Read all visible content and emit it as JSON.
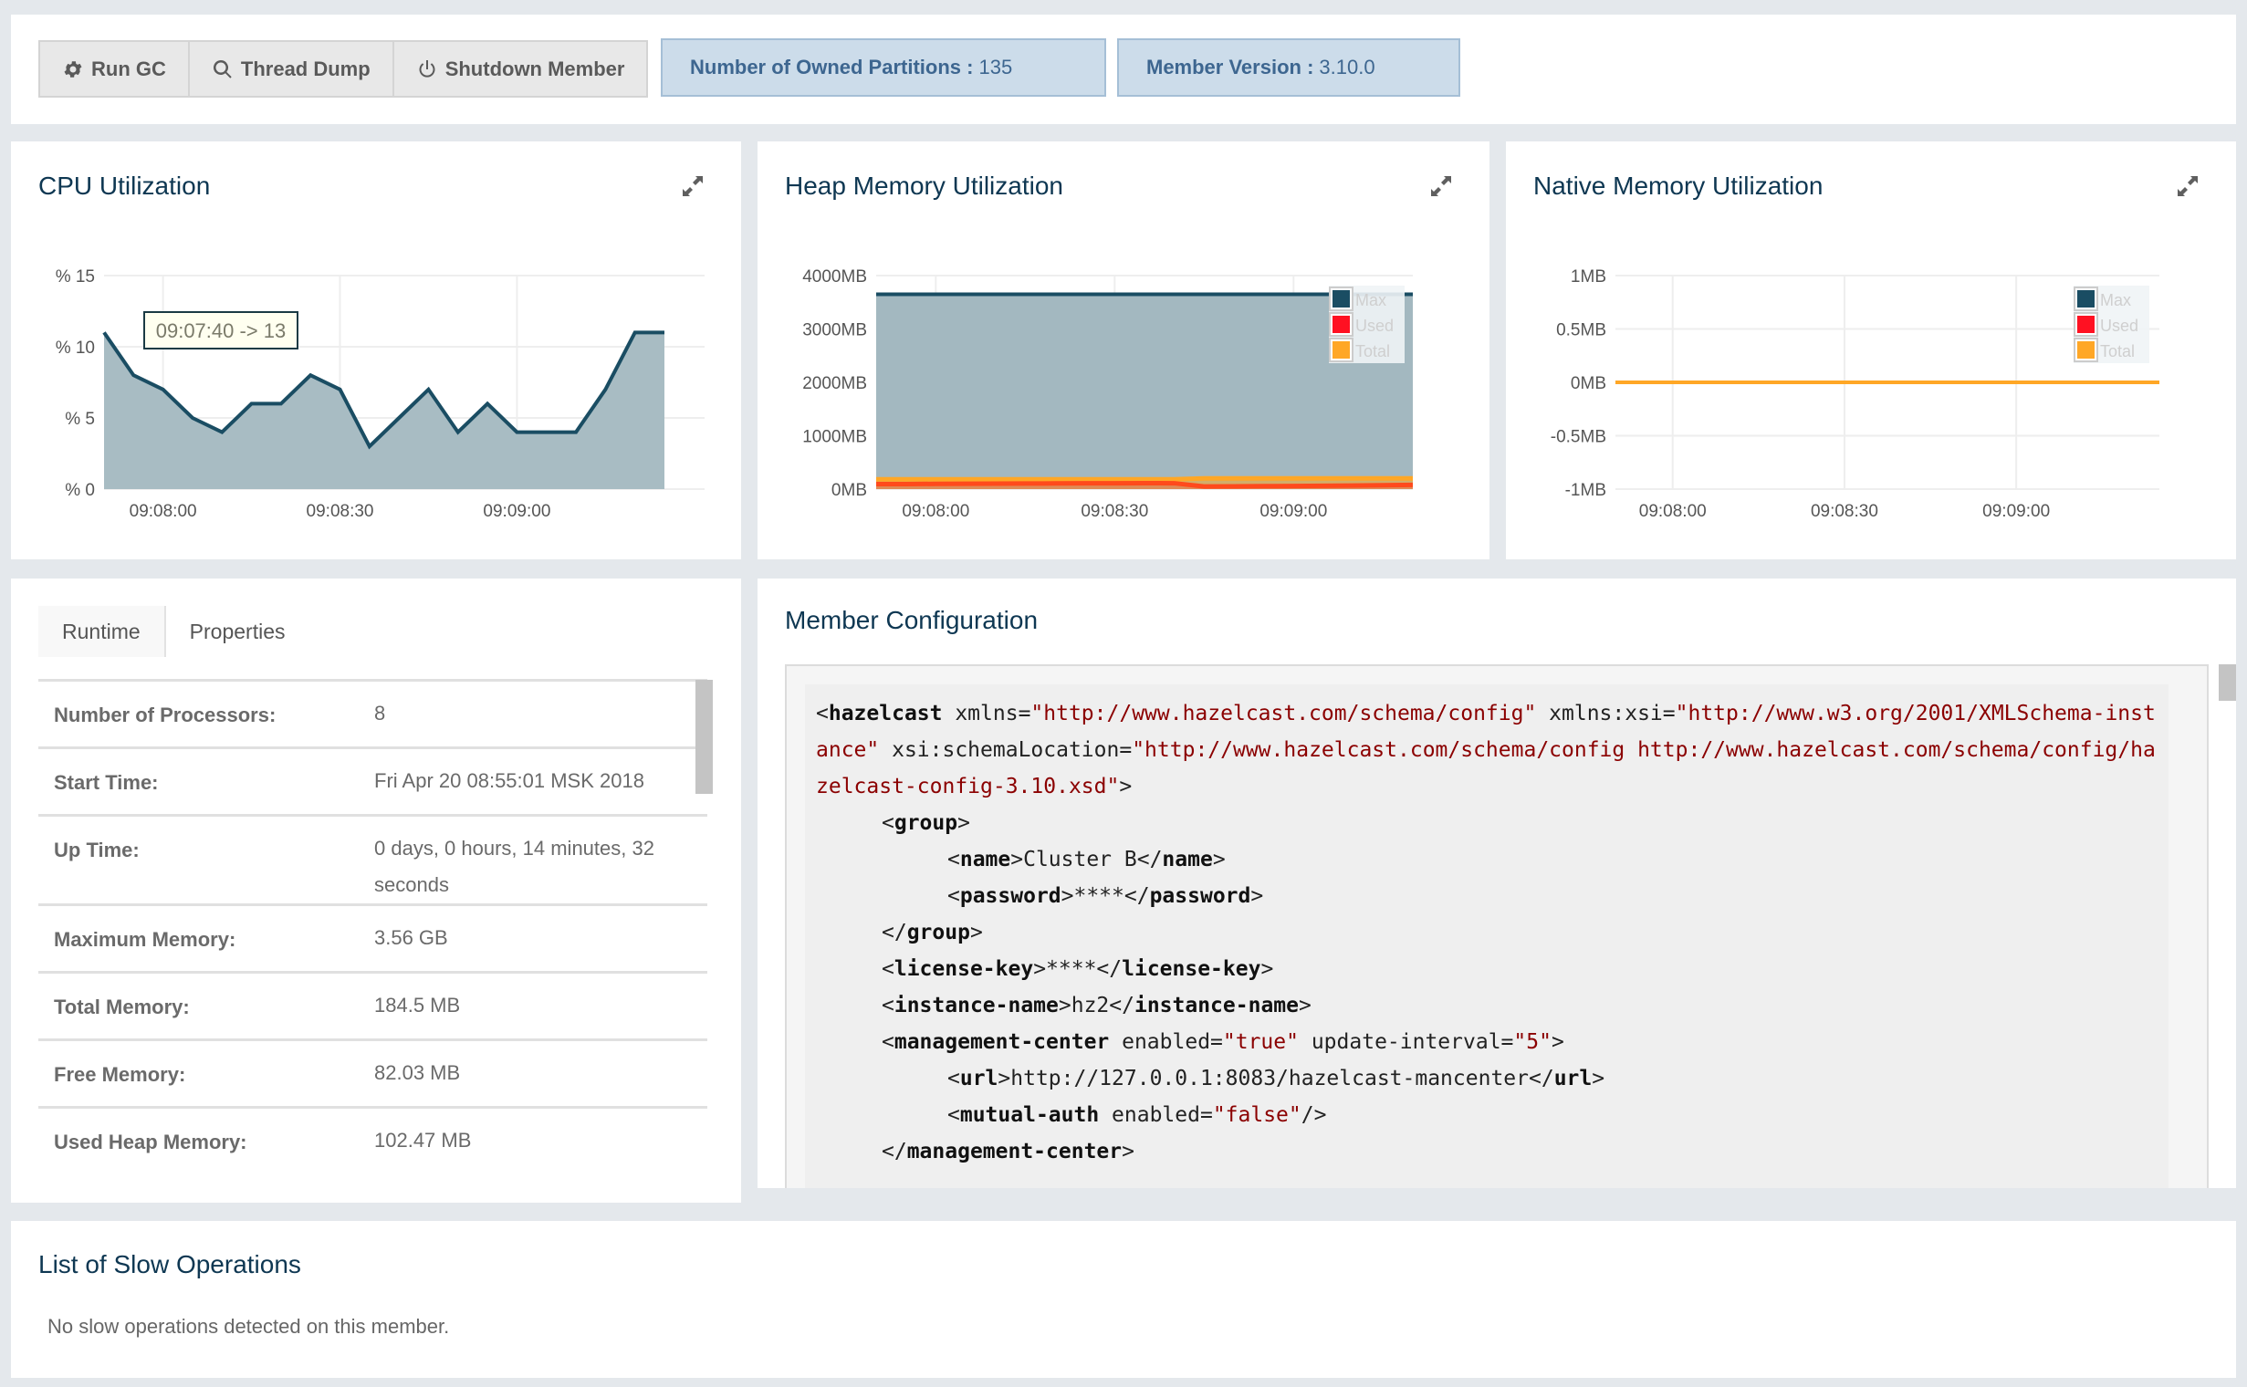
{
  "toolbar": {
    "buttons": [
      {
        "label": "Run GC",
        "icon": "gear-icon"
      },
      {
        "label": "Thread Dump",
        "icon": "search-icon"
      },
      {
        "label": "Shutdown Member",
        "icon": "power-icon"
      }
    ],
    "partitions": {
      "label": "Number of Owned Partitions :",
      "value": "135"
    },
    "version": {
      "label": "Member Version :",
      "value": "3.10.0"
    }
  },
  "charts": {
    "cpu": {
      "title": "CPU Utilization",
      "tooltip": "09:07:40 -> 13"
    },
    "heap": {
      "title": "Heap Memory Utilization"
    },
    "native": {
      "title": "Native Memory Utilization"
    }
  },
  "chart_data": [
    {
      "type": "area",
      "title": "CPU Utilization",
      "x": [
        "09:07:50",
        "09:07:55",
        "09:08:00",
        "09:08:05",
        "09:08:10",
        "09:08:15",
        "09:08:20",
        "09:08:25",
        "09:08:30",
        "09:08:35",
        "09:08:40",
        "09:08:45",
        "09:08:50",
        "09:08:55",
        "09:09:00",
        "09:09:05",
        "09:09:10",
        "09:09:15",
        "09:09:20",
        "09:09:25"
      ],
      "series": [
        {
          "name": "CPU",
          "values": [
            11,
            8,
            7,
            5,
            4,
            6,
            6,
            8,
            7,
            3,
            5,
            7,
            4,
            6,
            4,
            4,
            4,
            7,
            11,
            11
          ],
          "color": "#1a4d63",
          "fill": "#a3b8c0"
        }
      ],
      "yticks": [
        "% 0",
        "% 5",
        "% 10",
        "% 15"
      ],
      "ylim": [
        0,
        15
      ],
      "xticks": [
        "09:08:00",
        "09:08:30",
        "09:09:00"
      ],
      "tooltip": "09:07:40 -> 13",
      "grid": true
    },
    {
      "type": "area",
      "title": "Heap Memory Utilization",
      "x": [
        "09:07:50",
        "09:07:55",
        "09:08:00",
        "09:08:05",
        "09:08:10",
        "09:08:15",
        "09:08:20",
        "09:08:25",
        "09:08:30",
        "09:08:35",
        "09:08:40",
        "09:08:45",
        "09:08:50",
        "09:08:55",
        "09:09:00",
        "09:09:05",
        "09:09:10",
        "09:09:15",
        "09:09:20"
      ],
      "series": [
        {
          "name": "Max",
          "values": [
            3650,
            3650,
            3650,
            3650,
            3650,
            3650,
            3650,
            3650,
            3650,
            3650,
            3650,
            3650,
            3650,
            3650,
            3650,
            3650,
            3650,
            3650,
            3650
          ],
          "color": "#1a4d63"
        },
        {
          "name": "Used",
          "values": [
            95,
            95,
            98,
            100,
            102,
            104,
            106,
            108,
            110,
            112,
            110,
            50,
            52,
            55,
            58,
            62,
            66,
            72,
            80
          ],
          "color": "#ff1122"
        },
        {
          "name": "Total",
          "values": [
            184,
            184,
            184,
            184,
            184,
            184,
            184,
            184,
            184,
            184,
            184,
            200,
            200,
            200,
            200,
            200,
            200,
            200,
            200
          ],
          "color": "#ffa726"
        }
      ],
      "yticks": [
        "0MB",
        "1000MB",
        "2000MB",
        "3000MB",
        "4000MB"
      ],
      "ylim": [
        0,
        4000
      ],
      "xticks": [
        "09:08:00",
        "09:08:30",
        "09:09:00"
      ],
      "legend": "top-right",
      "grid": true
    },
    {
      "type": "line",
      "title": "Native Memory Utilization",
      "x": [
        "09:07:50",
        "09:09:25"
      ],
      "series": [
        {
          "name": "Max",
          "values": [
            0,
            0
          ],
          "color": "#1a4d63"
        },
        {
          "name": "Used",
          "values": [
            0,
            0
          ],
          "color": "#ff1122"
        },
        {
          "name": "Total",
          "values": [
            0,
            0
          ],
          "color": "#ffa726"
        }
      ],
      "yticks": [
        "-1MB",
        "-0.5MB",
        "0MB",
        "0.5MB",
        "1MB"
      ],
      "ylim": [
        -1,
        1
      ],
      "xticks": [
        "09:08:00",
        "09:08:30",
        "09:09:00"
      ],
      "legend": "top-right",
      "grid": true
    }
  ],
  "runtime": {
    "tabs": [
      {
        "label": "Runtime",
        "active": true
      },
      {
        "label": "Properties",
        "active": false
      }
    ],
    "rows": [
      {
        "key": "Number of Processors:",
        "value": "8"
      },
      {
        "key": "Start Time:",
        "value": "Fri Apr 20 08:55:01 MSK 2018"
      },
      {
        "key": "Up Time:",
        "value": "0 days, 0 hours, 14 minutes, 32 seconds"
      },
      {
        "key": "Maximum Memory:",
        "value": "3.56 GB"
      },
      {
        "key": "Total Memory:",
        "value": "184.5 MB"
      },
      {
        "key": "Free Memory:",
        "value": "82.03 MB"
      },
      {
        "key": "Used Heap Memory:",
        "value": "102.47 MB"
      }
    ]
  },
  "config": {
    "title": "Member Configuration",
    "lines": [
      {
        "indent": 0,
        "parts": [
          [
            "p",
            "<"
          ],
          [
            "tg",
            "hazelcast"
          ],
          [
            "an",
            " xmlns="
          ],
          [
            "av",
            "\"http://www.hazelcast.com/schema/config\""
          ],
          [
            "an",
            " xmlns:xsi="
          ],
          [
            "av",
            "\"http://www.w3.org/2001/XMLSchema-instance\""
          ],
          [
            "an",
            " xsi:schemaLocation="
          ],
          [
            "av",
            "\"http://www.hazelcast.com/schema/config http://www.hazelcast.com/schema/config/hazelcast-config-3.10.xsd\""
          ],
          [
            "p",
            ">"
          ]
        ]
      },
      {
        "indent": 1,
        "parts": [
          [
            "p",
            "<"
          ],
          [
            "tg",
            "group"
          ],
          [
            "p",
            ">"
          ]
        ]
      },
      {
        "indent": 2,
        "parts": [
          [
            "p",
            "<"
          ],
          [
            "tg",
            "name"
          ],
          [
            "p",
            ">Cluster B</"
          ],
          [
            "tg",
            "name"
          ],
          [
            "p",
            ">"
          ]
        ]
      },
      {
        "indent": 2,
        "parts": [
          [
            "p",
            "<"
          ],
          [
            "tg",
            "password"
          ],
          [
            "p",
            ">****</"
          ],
          [
            "tg",
            "password"
          ],
          [
            "p",
            ">"
          ]
        ]
      },
      {
        "indent": 1,
        "parts": [
          [
            "p",
            "</"
          ],
          [
            "tg",
            "group"
          ],
          [
            "p",
            ">"
          ]
        ]
      },
      {
        "indent": 1,
        "parts": [
          [
            "p",
            "<"
          ],
          [
            "tg",
            "license-key"
          ],
          [
            "p",
            ">****</"
          ],
          [
            "tg",
            "license-key"
          ],
          [
            "p",
            ">"
          ]
        ]
      },
      {
        "indent": 1,
        "parts": [
          [
            "p",
            "<"
          ],
          [
            "tg",
            "instance-name"
          ],
          [
            "p",
            ">hz2</"
          ],
          [
            "tg",
            "instance-name"
          ],
          [
            "p",
            ">"
          ]
        ]
      },
      {
        "indent": 1,
        "parts": [
          [
            "p",
            "<"
          ],
          [
            "tg",
            "management-center"
          ],
          [
            "an",
            " enabled="
          ],
          [
            "av",
            "\"true\""
          ],
          [
            "an",
            " update-interval="
          ],
          [
            "av",
            "\"5\""
          ],
          [
            "p",
            ">"
          ]
        ]
      },
      {
        "indent": 2,
        "parts": [
          [
            "p",
            "<"
          ],
          [
            "tg",
            "url"
          ],
          [
            "p",
            ">http://127.0.0.1:8083/hazelcast-mancenter</"
          ],
          [
            "tg",
            "url"
          ],
          [
            "p",
            ">"
          ]
        ]
      },
      {
        "indent": 2,
        "parts": [
          [
            "p",
            "<"
          ],
          [
            "tg",
            "mutual-auth"
          ],
          [
            "an",
            " enabled="
          ],
          [
            "av",
            "\"false\""
          ],
          [
            "p",
            "/>"
          ]
        ]
      },
      {
        "indent": 1,
        "parts": [
          [
            "p",
            "</"
          ],
          [
            "tg",
            "management-center"
          ],
          [
            "p",
            ">"
          ]
        ]
      }
    ]
  },
  "slow_ops": {
    "title": "List of Slow Operations",
    "message": "No slow operations detected on this member."
  }
}
